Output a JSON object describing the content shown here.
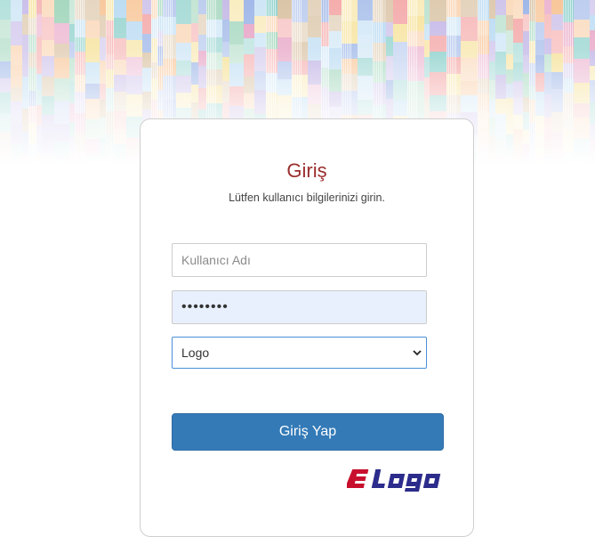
{
  "login": {
    "title": "Giriş",
    "subtitle": "Lütfen kullanıcı bilgilerinizi girin.",
    "username_placeholder": "Kullanıcı Adı",
    "username_value": "",
    "password_value": "••••••••",
    "company_select": {
      "selected": "Logo",
      "options": [
        "Logo"
      ]
    },
    "submit_label": "Giriş Yap"
  },
  "brand": {
    "logo_name": "elogo-logo",
    "logo_text": "elogo",
    "logo_color": "#c8102e",
    "title_color": "#9b2d2d",
    "button_color": "#337ab7",
    "banner_palette": [
      "#f4a6a6",
      "#8fd1cc",
      "#bcdcf3",
      "#f8c79a",
      "#c3b6e6",
      "#a7d8c0",
      "#f6e29b",
      "#9fb7e8",
      "#e8a8c8",
      "#d9c2a3"
    ]
  }
}
